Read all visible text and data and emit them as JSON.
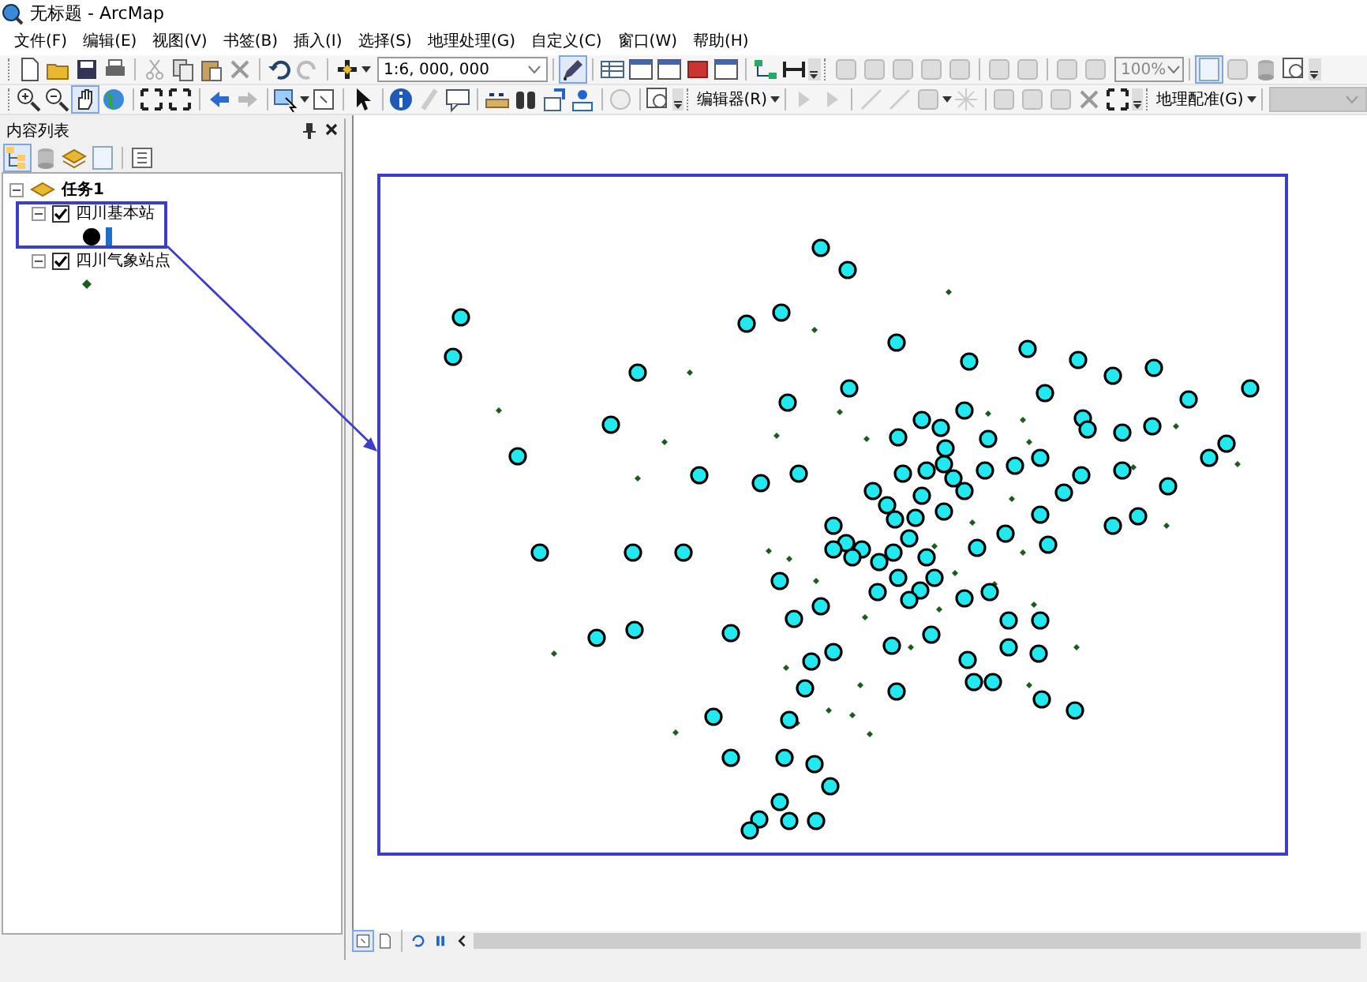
{
  "window": {
    "title": "无标题 - ArcMap"
  },
  "menu": [
    "文件(F)",
    "编辑(E)",
    "视图(V)",
    "书签(B)",
    "插入(I)",
    "选择(S)",
    "地理处理(G)",
    "自定义(C)",
    "窗口(W)",
    "帮助(H)"
  ],
  "toolbar": {
    "scale": "1:6, 000, 000",
    "zoom": "100%",
    "editor_menu": "编辑器(R)",
    "georef_menu": "地理配准(G)"
  },
  "toc": {
    "title": "内容列表",
    "tree": [
      {
        "name": "任务1",
        "expanded": true,
        "children": [
          {
            "name": "四川基本站",
            "checked": true,
            "expanded": true,
            "kind": "circle"
          },
          {
            "name": "四川气象站点",
            "checked": true,
            "expanded": true,
            "kind": "dot"
          }
        ]
      }
    ]
  }
}
